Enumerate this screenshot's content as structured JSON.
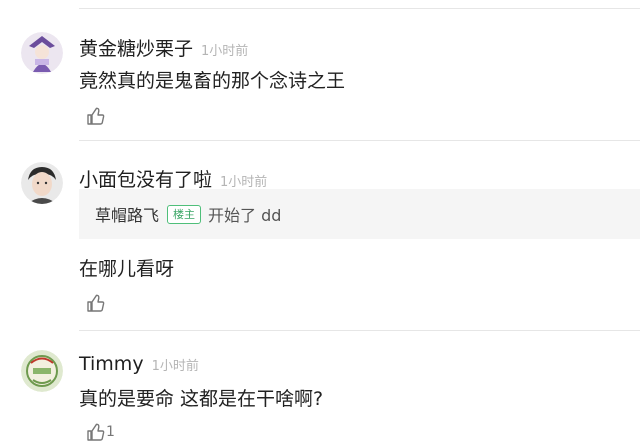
{
  "comments": [
    {
      "username": "黄金糖炒栗子",
      "time": "1小时前",
      "text": "竟然真的是鬼畜的那个念诗之王",
      "likes": ""
    },
    {
      "username": "小面包没有了啦",
      "time": "1小时前",
      "quote": {
        "username": "草帽路飞",
        "badge": "楼主",
        "text": "开始了 dd"
      },
      "text": "在哪儿看呀",
      "likes": ""
    },
    {
      "username": "Timmy",
      "time": "1小时前",
      "text": "真的是要命 这都是在干啥啊?",
      "likes": "1"
    }
  ],
  "icons": {
    "like": "thumbs-up-icon"
  },
  "colors": {
    "badge_green": "#3aa565",
    "divider": "#e6e6e6",
    "quote_bg": "#f5f5f5",
    "time_gray": "#b5b5b5"
  }
}
